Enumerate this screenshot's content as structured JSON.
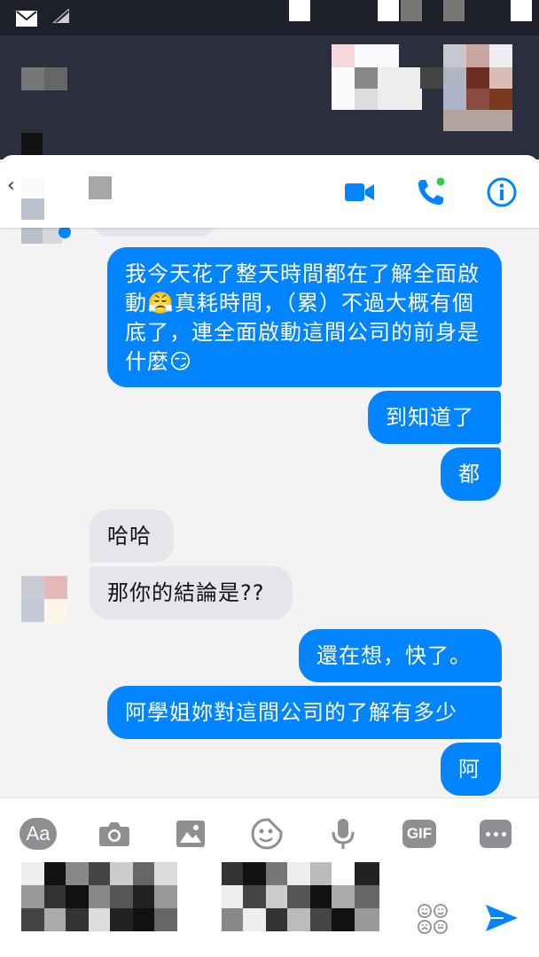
{
  "header": {
    "name_hidden": true
  },
  "icons": {
    "video": "video-camera-icon",
    "call": "phone-call-icon",
    "info": "info-icon",
    "camera": "camera-icon",
    "image": "image-icon",
    "sticker": "sticker-icon",
    "mic": "microphone-icon",
    "more": "more-icon",
    "emoji": "emoji-icon",
    "send": "send-icon"
  },
  "colors": {
    "accent": "#0084ff",
    "incoming_bubble": "#e4e6eb",
    "online": "#31cc46"
  },
  "messages": [
    {
      "id": "m1",
      "direction": "out",
      "text": "我今天花了整天時間都在了解全面啟動😤真耗時間，（累）不過大概有個底了，連全面啟動這間公司的前身是什麼😏"
    },
    {
      "id": "m2",
      "direction": "out",
      "text": "到知道了"
    },
    {
      "id": "m3",
      "direction": "out",
      "text": "都"
    },
    {
      "id": "m4",
      "direction": "in",
      "text": "哈哈"
    },
    {
      "id": "m5",
      "direction": "in",
      "text": "那你的結論是??"
    },
    {
      "id": "m6",
      "direction": "out",
      "text": "還在想，快了。"
    },
    {
      "id": "m7",
      "direction": "out",
      "text": "阿學姐妳對這間公司的了解有多少"
    },
    {
      "id": "m8",
      "direction": "out",
      "text": "阿"
    }
  ],
  "composer": {
    "aa_label": "Aa",
    "gif_label": "GIF"
  }
}
